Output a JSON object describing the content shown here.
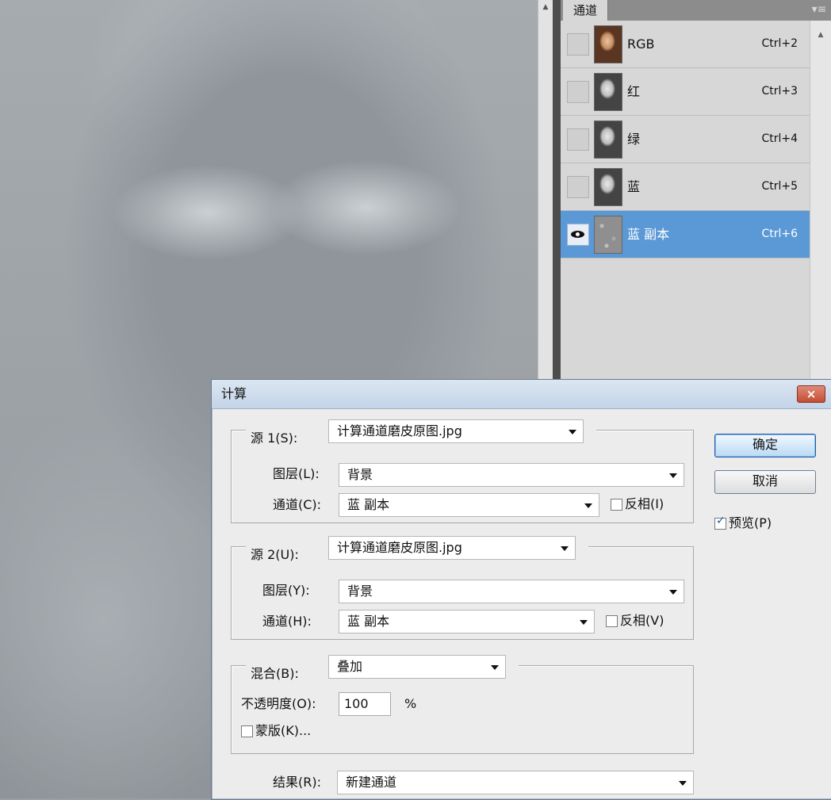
{
  "colors": {
    "panel_selected_bg": "#5b99d6",
    "dialog_bg": "#ececec",
    "close_button_red": "#c54c33"
  },
  "icons": {
    "panel_menu": "panel-menu-icon",
    "visibility": "eye-icon",
    "dropdown": "chevron-down-icon",
    "close": "close-icon",
    "scroll_up": "scroll-up-icon"
  },
  "channels_panel": {
    "tab_label": "通道",
    "menu_glyph": "▾≡",
    "scroll_up_glyph": "▲",
    "rows": [
      {
        "name": "RGB",
        "shortcut": "Ctrl+2",
        "visible": false,
        "selected": false
      },
      {
        "name": "红",
        "shortcut": "Ctrl+3",
        "visible": false,
        "selected": false
      },
      {
        "name": "绿",
        "shortcut": "Ctrl+4",
        "visible": false,
        "selected": false
      },
      {
        "name": "蓝",
        "shortcut": "Ctrl+5",
        "visible": false,
        "selected": false
      },
      {
        "name": "蓝 副本",
        "shortcut": "Ctrl+6",
        "visible": true,
        "selected": true
      }
    ]
  },
  "canvas_scrollbar": {
    "scroll_up_glyph": "▲"
  },
  "dialog": {
    "title": "计算",
    "close_glyph": "×",
    "source1": {
      "label": "源 1(S):",
      "value": "计算通道磨皮原图.jpg",
      "layer_label": "图层(L):",
      "layer_value": "背景",
      "channel_label": "通道(C):",
      "channel_value": "蓝 副本",
      "invert_label": "反相(I)",
      "invert_checked": false
    },
    "source2": {
      "label": "源 2(U):",
      "value": "计算通道磨皮原图.jpg",
      "layer_label": "图层(Y):",
      "layer_value": "背景",
      "channel_label": "通道(H):",
      "channel_value": "蓝 副本",
      "invert_label": "反相(V)",
      "invert_checked": false
    },
    "blend": {
      "label": "混合(B):",
      "value": "叠加",
      "opacity_label": "不透明度(O):",
      "opacity_value": "100",
      "opacity_unit": "%",
      "mask_label": "蒙版(K)...",
      "mask_checked": false
    },
    "result": {
      "label": "结果(R):",
      "value": "新建通道"
    },
    "ok_label": "确定",
    "cancel_label": "取消",
    "preview_label": "预览(P)",
    "preview_checked": true
  }
}
